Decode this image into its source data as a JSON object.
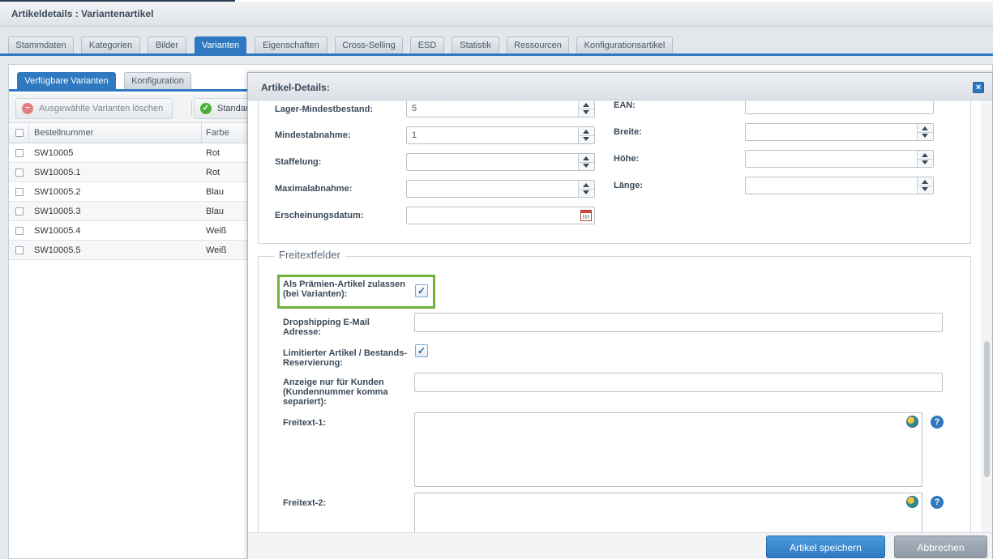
{
  "window": {
    "title": "Artikeldetails : Variantenartikel"
  },
  "main_tabs": [
    {
      "label": "Stammdaten",
      "active": false
    },
    {
      "label": "Kategorien",
      "active": false
    },
    {
      "label": "Bilder",
      "active": false
    },
    {
      "label": "Varianten",
      "active": true
    },
    {
      "label": "Eigenschaften",
      "active": false
    },
    {
      "label": "Cross-Selling",
      "active": false
    },
    {
      "label": "ESD",
      "active": false
    },
    {
      "label": "Statistik",
      "active": false
    },
    {
      "label": "Ressourcen",
      "active": false
    },
    {
      "label": "Konfigurationsartikel",
      "active": false
    }
  ],
  "variant_panel": {
    "tabs": [
      {
        "label": "Verfügbare Varianten",
        "active": true
      },
      {
        "label": "Konfiguration",
        "active": false
      }
    ],
    "toolbar": {
      "delete_label": "Ausgewählte Varianten löschen",
      "standard_label": "Standard"
    },
    "columns": [
      "Bestellnummer",
      "Farbe"
    ],
    "rows": [
      {
        "number": "SW10005",
        "color": "Rot"
      },
      {
        "number": "SW10005.1",
        "color": "Rot"
      },
      {
        "number": "SW10005.2",
        "color": "Blau"
      },
      {
        "number": "SW10005.3",
        "color": "Blau"
      },
      {
        "number": "SW10005.4",
        "color": "Weiß"
      },
      {
        "number": "SW10005.5",
        "color": "Weiß"
      }
    ]
  },
  "dialog": {
    "title": "Artikel-Details:",
    "close_icon": "close-icon",
    "left_fields": [
      {
        "label": "Lager-Mindestbestand:",
        "value": "5",
        "kind": "number"
      },
      {
        "label": "Mindestabnahme:",
        "value": "1",
        "kind": "number"
      },
      {
        "label": "Staffelung:",
        "value": "",
        "kind": "number"
      },
      {
        "label": "Maximalabnahme:",
        "value": "",
        "kind": "number"
      },
      {
        "label": "Erscheinungsdatum:",
        "value": "",
        "kind": "date"
      }
    ],
    "right_fields": [
      {
        "label": "EAN:",
        "value": "",
        "kind": "text"
      },
      {
        "label": "Breite:",
        "value": "",
        "kind": "number"
      },
      {
        "label": "Höhe:",
        "value": "",
        "kind": "number"
      },
      {
        "label": "Länge:",
        "value": "",
        "kind": "number"
      }
    ],
    "freitext": {
      "legend": "Freitextfelder",
      "premium_label": "Als Prämien-Artikel zulassen (bei Varianten):",
      "premium_checked": true,
      "dropship_label": "Dropshipping E-Mail Adresse:",
      "dropship_value": "",
      "limited_label": "Limitierter Artikel / Bestands-Reservierung:",
      "limited_checked": true,
      "customers_label": "Anzeige nur für Kunden (Kundennummer komma separiert):",
      "customers_value": "",
      "freitext1_label": "Freitext-1:",
      "freitext1_value": "",
      "freitext2_label": "Freitext-2:",
      "freitext2_value": "",
      "check_glyph": "✓",
      "help_glyph": "?"
    },
    "footer": {
      "save_label": "Artikel speichern",
      "cancel_label": "Abbrechen"
    }
  },
  "colors": {
    "accent": "#2f79c1",
    "highlight": "#6fb23a",
    "cancel": "#8e9aa6"
  }
}
